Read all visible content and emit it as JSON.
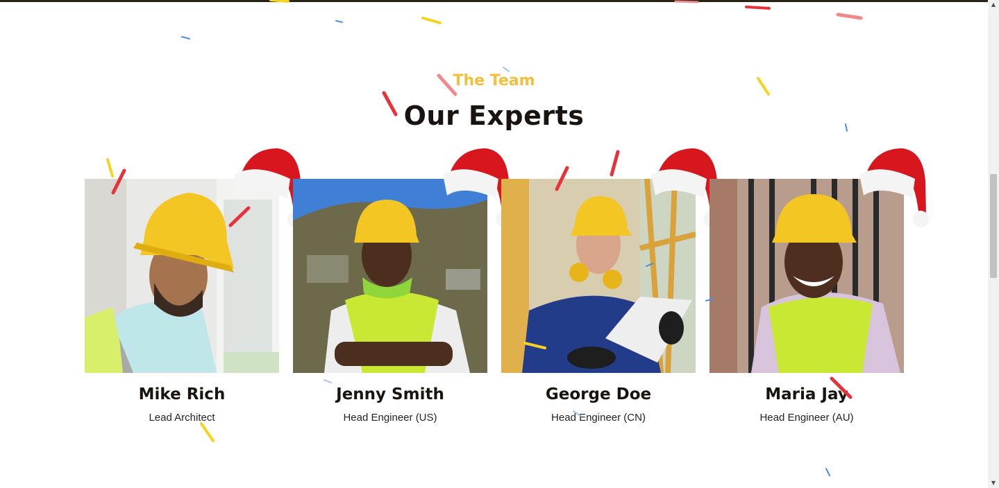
{
  "section": {
    "eyebrow": "The Team",
    "title": "Our Experts"
  },
  "team": [
    {
      "name": "Mike Rich",
      "role": "Lead Architect",
      "photo_icon": "worker-hardhat-photo"
    },
    {
      "name": "Jenny Smith",
      "role": "Head Engineer (US)",
      "photo_icon": "worker-hardhat-photo"
    },
    {
      "name": "George Doe",
      "role": "Head Engineer (CN)",
      "photo_icon": "worker-hardhat-photo"
    },
    {
      "name": "Maria Jay",
      "role": "Head Engineer (AU)",
      "photo_icon": "worker-hardhat-photo"
    }
  ],
  "decor": {
    "hat_icon": "santa-hat-icon",
    "confetti_colors": [
      "#e8323a",
      "#f5d31e",
      "#4a8fe0",
      "#f08a8a"
    ]
  },
  "colors": {
    "accent": "#f4bf3a",
    "heading": "#1a1410"
  }
}
